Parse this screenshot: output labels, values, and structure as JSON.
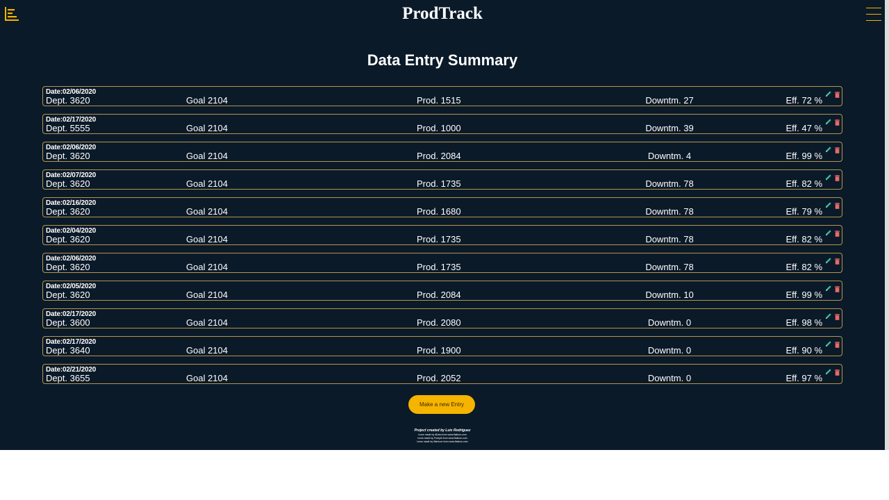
{
  "app": {
    "brand": "ProdTrack",
    "icons": {
      "logo": "chart-logo-icon",
      "menu": "hamburger-menu-icon",
      "edit": "pencil-icon",
      "delete": "trash-icon"
    },
    "colors": {
      "background": "#0b1a29",
      "accent": "#f5b400",
      "border": "#b5954a",
      "edit": "#2ec4a3",
      "delete": "#e86a6a"
    }
  },
  "page": {
    "title": "Data Entry Summary"
  },
  "entries": [
    {
      "date": "Date:02/06/2020",
      "dept": "Dept. 3620",
      "goal": "Goal 2104",
      "prod": "Prod. 1515",
      "downtime": "Downtm. 27",
      "eff": "Eff. 72 %"
    },
    {
      "date": "Date:02/17/2020",
      "dept": "Dept. 5555",
      "goal": "Goal 2104",
      "prod": "Prod. 1000",
      "downtime": "Downtm. 39",
      "eff": "Eff. 47 %"
    },
    {
      "date": "Date:02/06/2020",
      "dept": "Dept. 3620",
      "goal": "Goal 2104",
      "prod": "Prod. 2084",
      "downtime": "Downtm. 4",
      "eff": "Eff. 99 %"
    },
    {
      "date": "Date:02/07/2020",
      "dept": "Dept. 3620",
      "goal": "Goal 2104",
      "prod": "Prod. 1735",
      "downtime": "Downtm. 78",
      "eff": "Eff. 82 %"
    },
    {
      "date": "Date:02/16/2020",
      "dept": "Dept. 3620",
      "goal": "Goal 2104",
      "prod": "Prod. 1680",
      "downtime": "Downtm. 78",
      "eff": "Eff. 79 %"
    },
    {
      "date": "Date:02/04/2020",
      "dept": "Dept. 3620",
      "goal": "Goal 2104",
      "prod": "Prod. 1735",
      "downtime": "Downtm. 78",
      "eff": "Eff. 82 %"
    },
    {
      "date": "Date:02/06/2020",
      "dept": "Dept. 3620",
      "goal": "Goal 2104",
      "prod": "Prod. 1735",
      "downtime": "Downtm. 78",
      "eff": "Eff. 82 %"
    },
    {
      "date": "Date:02/05/2020",
      "dept": "Dept. 3620",
      "goal": "Goal 2104",
      "prod": "Prod. 2084",
      "downtime": "Downtm. 10",
      "eff": "Eff. 99 %"
    },
    {
      "date": "Date:02/17/2020",
      "dept": "Dept. 3600",
      "goal": "Goal 2104",
      "prod": "Prod. 2080",
      "downtime": "Downtm. 0",
      "eff": "Eff. 98 %"
    },
    {
      "date": "Date:02/17/2020",
      "dept": "Dept. 3640",
      "goal": "Goal 2104",
      "prod": "Prod. 1900",
      "downtime": "Downtm. 0",
      "eff": "Eff. 90 %"
    },
    {
      "date": "Date:02/21/2020",
      "dept": "Dept. 3655",
      "goal": "Goal 2104",
      "prod": "Prod. 2052",
      "downtime": "Downtm. 0",
      "eff": "Eff. 97 %"
    }
  ],
  "actions": {
    "new_entry_label": "Make a new Entry"
  },
  "footer": {
    "credit": "Project created by Luis Rodriguez",
    "icon_credits": [
      "Icons made by dDara from www.flaticon.com",
      "Icons made by Freepik from www.flaticon.com",
      "Icons made by Wanicon from www.flaticon.com"
    ]
  }
}
